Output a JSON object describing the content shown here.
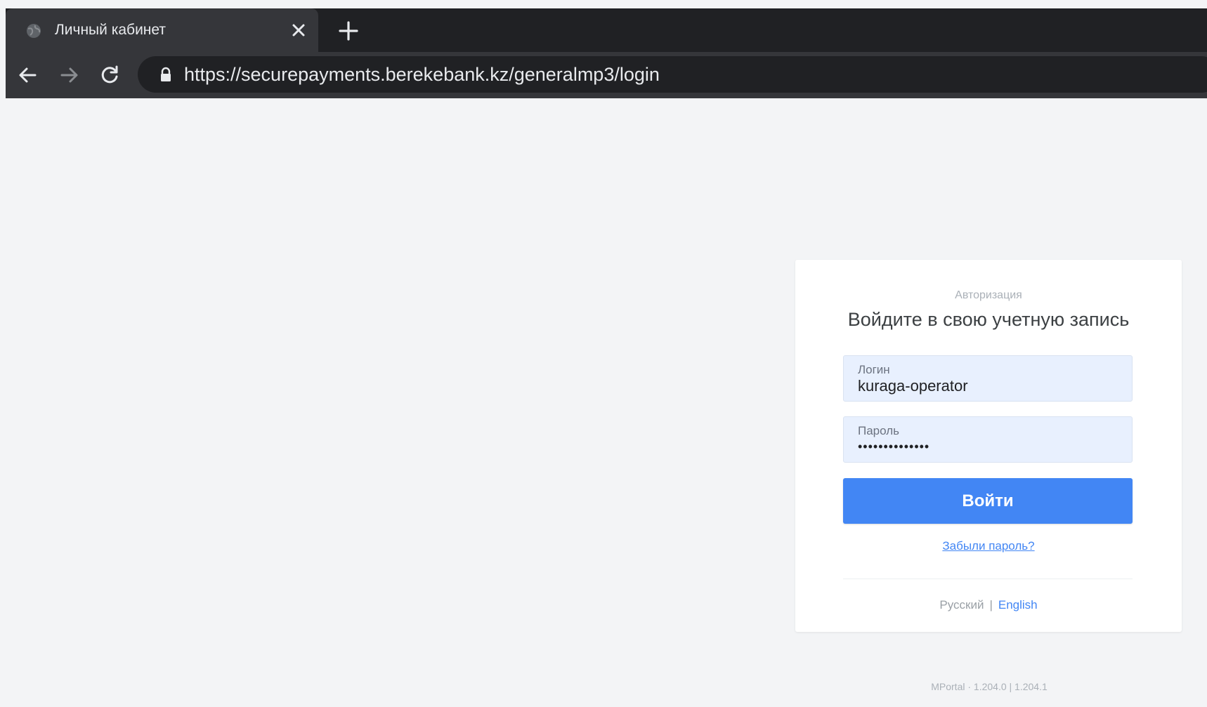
{
  "browser": {
    "tab_title": "Личный кабинет",
    "url": "https://securepayments.berekebank.kz/generalmp3/login",
    "icons": {
      "favicon": "globe-icon",
      "close": "close-icon",
      "new_tab": "plus-icon",
      "back": "arrow-left-icon",
      "forward": "arrow-right-icon",
      "reload": "reload-icon",
      "lock": "lock-icon"
    }
  },
  "login": {
    "eyebrow": "Авторизация",
    "headline": "Войдите в свою учетную запись",
    "username_label": "Логин",
    "username_value": "kuraga-operator",
    "password_label": "Пароль",
    "password_value": "••••••••••••••",
    "submit_label": "Войти",
    "forgot_password": "Забыли пароль?",
    "lang_ru": "Русский",
    "lang_separator": "|",
    "lang_en": "English"
  },
  "footer": {
    "version": "MPortal · 1.204.0 | 1.204.1"
  },
  "colors": {
    "accent": "#4286f4",
    "input_bg": "#e8f0fe",
    "page_bg": "#f3f4f6",
    "chrome_dark": "#202124"
  }
}
